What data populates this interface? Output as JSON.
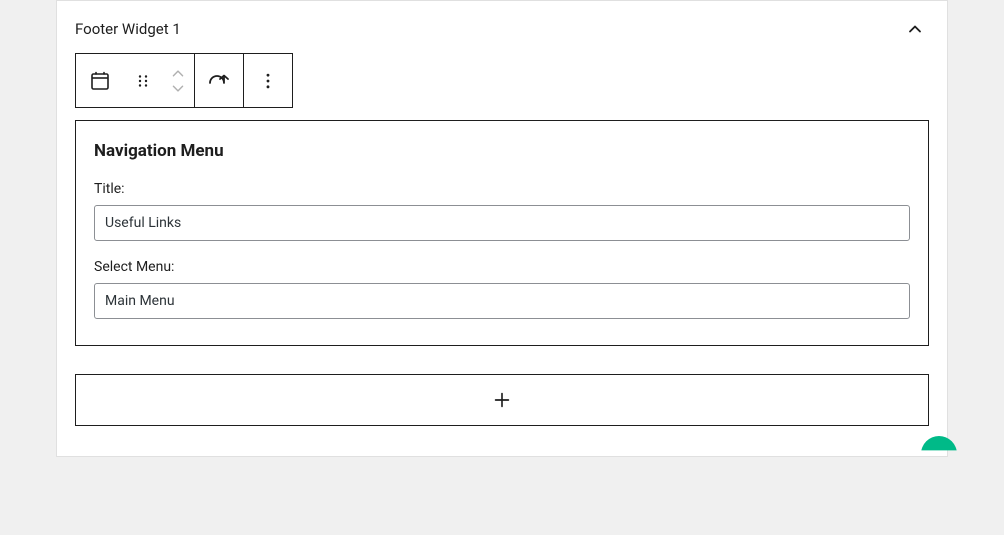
{
  "panel": {
    "title": "Footer Widget 1"
  },
  "widget": {
    "heading": "Navigation Menu",
    "title_label": "Title:",
    "title_value": "Useful Links",
    "select_label": "Select Menu:",
    "select_value": "Main Menu"
  }
}
